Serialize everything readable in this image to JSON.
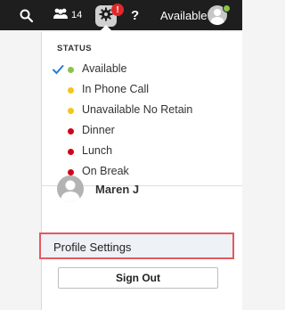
{
  "topbar": {
    "people_count": "14",
    "notification_badge": "!",
    "help_glyph": "?",
    "current_status": "Available",
    "icons": [
      "search-icon",
      "people-icon",
      "gear-icon",
      "help-icon",
      "avatar-icon"
    ]
  },
  "menu": {
    "section_title": "STATUS",
    "statuses": [
      {
        "label": "Available",
        "color": "#8bc34a",
        "selected": true
      },
      {
        "label": "In Phone Call",
        "color": "#f5c518",
        "selected": false
      },
      {
        "label": "Unavailable No Retain",
        "color": "#f5c518",
        "selected": false
      },
      {
        "label": "Dinner",
        "color": "#d0021b",
        "selected": false
      },
      {
        "label": "Lunch",
        "color": "#d0021b",
        "selected": false
      },
      {
        "label": "On Break",
        "color": "#d0021b",
        "selected": false
      }
    ],
    "user_name": "Maren J",
    "profile_settings_label": "Profile Settings",
    "sign_out_label": "Sign Out"
  },
  "colors": {
    "topbar_bg": "#1e1e1e",
    "highlight_border": "#e2595d",
    "check_blue": "#2b7bd6"
  }
}
